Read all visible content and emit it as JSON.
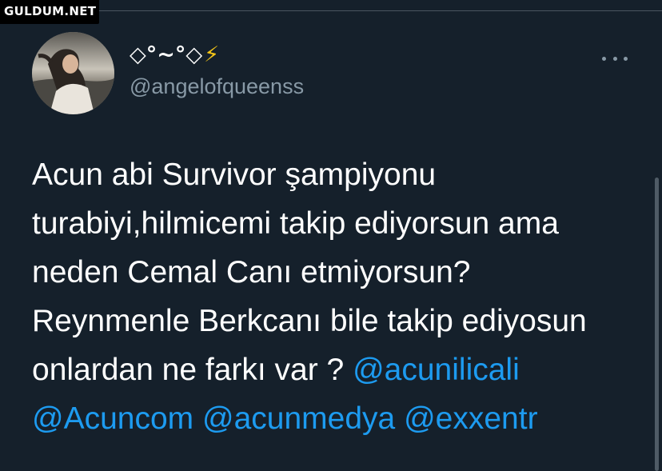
{
  "watermark": {
    "text": "GULDUM.NET"
  },
  "user": {
    "display_name": "◇°~°◇",
    "bolt": "⚡",
    "handle": "@angelofqueenss"
  },
  "tweet": {
    "text_parts": [
      "Acun abi Survivor şampiyonu",
      "turabiyi,hilmicemi takip ediyorsun ama",
      "neden Cemal Canı etmiyorsun?",
      "Reynmenle Berkcanı bile takip ediyosun",
      "onlardan ne farkı var ? "
    ],
    "mentions": [
      "@acunilicali",
      "@Acuncom",
      "@acunmedya",
      "@exxentr"
    ]
  },
  "colors": {
    "background": "#15202b",
    "text": "#ffffff",
    "secondary": "#8899a6",
    "mention": "#1d9bf0",
    "bolt": "#f5c518"
  },
  "icons": {
    "avatar": "profile-photo",
    "more": "more-horizontal-icon"
  }
}
